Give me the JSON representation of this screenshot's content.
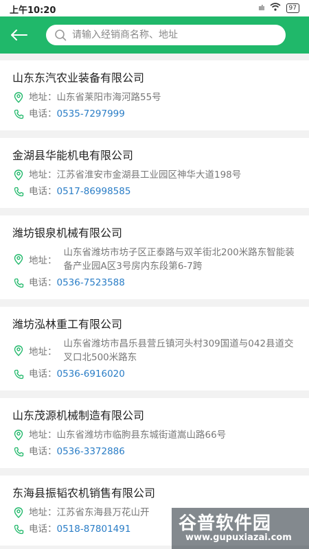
{
  "status": {
    "time": "上午10:20",
    "signal": "ıılı",
    "battery": "97"
  },
  "header": {
    "search_placeholder": "请输入经销商名称、地址"
  },
  "dealers": [
    {
      "name": "山东东汽农业装备有限公司",
      "address_label": "地址：",
      "address": "山东省莱阳市海河路55号",
      "phone_label": "电话：",
      "phone": "0535-7297999"
    },
    {
      "name": "金湖县华能机电有限公司",
      "address_label": "地址：",
      "address": "江苏省淮安市金湖县工业园区神华大道198号",
      "phone_label": "电话：",
      "phone": "0517-86998585"
    },
    {
      "name": "潍坊银泉机械有限公司",
      "address_label": "地址：",
      "address": "山东省潍坊市坊子区正泰路与双羊街北200米路东智能装备产业园A区3号房内东段第6-7跨",
      "phone_label": "电话：",
      "phone": "0536-7523588"
    },
    {
      "name": "潍坊泓林重工有限公司",
      "address_label": "地址：",
      "address": "山东省潍坊市昌乐县营丘镇河头村309国道与042县道交叉口北500米路东",
      "phone_label": "电话：",
      "phone": "0536-6916020"
    },
    {
      "name": "山东茂源机械制造有限公司",
      "address_label": "地址：",
      "address": "山东省潍坊市临朐县东城街道嵩山路66号",
      "phone_label": "电话：",
      "phone": "0536-3372886"
    },
    {
      "name": "东海县振韬农机销售有限公司",
      "address_label": "地址：",
      "address": "江苏省东海县万花山开",
      "phone_label": "电话：",
      "phone": "0518-87801491"
    }
  ],
  "watermark": {
    "title": "谷普软件园",
    "url": "www.gupuxiazai.com"
  },
  "colors": {
    "brand_green": "#20b86a",
    "phone_blue": "#2a7dc6"
  }
}
